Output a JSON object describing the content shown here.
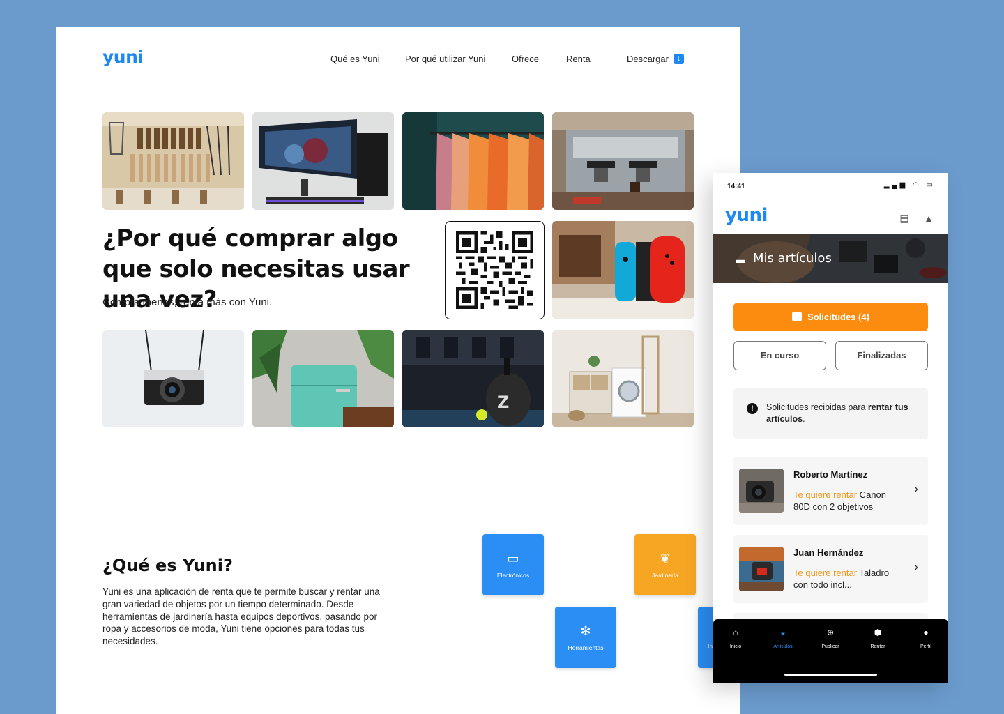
{
  "web": {
    "logo": "yuni",
    "nav": [
      "Qué es Yuni",
      "Por qué utilizar Yuni",
      "Ofrece",
      "Renta",
      "Descargar"
    ],
    "hero_title": "¿Por qué comprar algo que solo necesitas usar una vez?",
    "hero_sub": "Compra menos, renta más con Yuni.",
    "what_title": "¿Qué es Yuni?",
    "what_text": "Yuni es una aplicación de renta que te permite buscar y rentar una gran variedad de objetos por un tiempo determinado. Desde herramientas de jardinería hasta equipos deportivos, pasando por ropa y accesorios de moda, Yuni tiene opciones para todas tus necesidades.",
    "categories": [
      {
        "label": "Electrónicos",
        "icon": "laptop-icon",
        "color": "#2b8ef5"
      },
      {
        "label": "Jardinería",
        "icon": "leaf-icon",
        "color": "#f6a623"
      },
      {
        "label": "Herramientas",
        "icon": "gear-icon",
        "color": "#2b8ef5"
      },
      {
        "label": "In",
        "icon": "",
        "color": "#2b8ef5"
      }
    ]
  },
  "phone": {
    "time": "14:41",
    "logo": "yuni",
    "banner_label": "Mis artículos",
    "primary_button": "Solicitudes (4)",
    "tab_in_progress": "En curso",
    "tab_finished": "Finalizadas",
    "info_prefix": "Solicitudes recibidas para ",
    "info_bold": "rentar tus artículos",
    "info_suffix": ".",
    "requests": [
      {
        "name": "Roberto Martínez",
        "highlight": "Te quiere rentar",
        "item": " Canon 80D con 2 objetivos"
      },
      {
        "name": "Juan Hernández",
        "highlight": "Te quiere rentar",
        "item": " Taladro con todo incl..."
      }
    ],
    "tabbar": [
      {
        "label": "Inicio",
        "icon": "home-icon",
        "active": false
      },
      {
        "label": "Artículos",
        "icon": "box-icon",
        "active": true
      },
      {
        "label": "Publicar",
        "icon": "plus-icon",
        "active": false
      },
      {
        "label": "Rentar",
        "icon": "package-icon",
        "active": false
      },
      {
        "label": "Perfil",
        "icon": "user-icon",
        "active": false
      }
    ]
  },
  "colors": {
    "brand": "#1e88f2",
    "accent": "#fb8c0f",
    "background": "#6b9bcd"
  }
}
